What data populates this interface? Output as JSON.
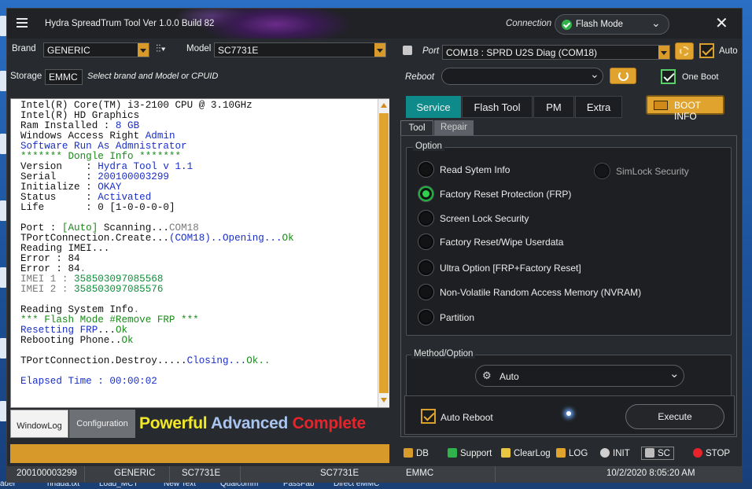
{
  "window": {
    "title": "Hydra SpreadTrum Tool  Ver 1.0.0 Build 82",
    "connection_label": "Connection",
    "connection_mode": "Flash Mode",
    "close_glyph": "✕"
  },
  "device": {
    "brand_label": "Brand",
    "brand_value": "GENERIC",
    "model_label": "Model",
    "model_value": "SC7731E",
    "storage_label": "Storage",
    "storage_value": "EMMC",
    "hint": "Select brand and Model or CPUID"
  },
  "port": {
    "label": "Port",
    "value": "COM18 : SPRD U2S Diag (COM18)",
    "auto_label": "Auto",
    "auto_checked": true,
    "reboot_label": "Reboot",
    "reboot_value": "",
    "one_boot_label": "One Boot",
    "one_boot_checked": true
  },
  "log": {
    "lines": [
      [
        {
          "t": "Intel(R) Core(TM) i3-2100 CPU @ 3.10GHz",
          "c": ""
        }
      ],
      [
        {
          "t": "Intel(R) HD Graphics",
          "c": ""
        }
      ],
      [
        {
          "t": "Ram Installed : ",
          "c": ""
        },
        {
          "t": "8 GB",
          "c": "c-blue"
        }
      ],
      [
        {
          "t": "Windows Access Right ",
          "c": ""
        },
        {
          "t": "Admin",
          "c": "c-blue"
        }
      ],
      [
        {
          "t": "Software Run As Admnistrator",
          "c": "c-blue"
        }
      ],
      [
        {
          "t": "******* Dongle Info *******",
          "c": "c-green"
        }
      ],
      [
        {
          "t": "Version    : ",
          "c": ""
        },
        {
          "t": "Hydra Tool v 1.1",
          "c": "c-blue"
        }
      ],
      [
        {
          "t": "Serial     : ",
          "c": ""
        },
        {
          "t": "200100003299",
          "c": "c-blue"
        }
      ],
      [
        {
          "t": "Initialize : ",
          "c": ""
        },
        {
          "t": "OKAY",
          "c": "c-blue"
        }
      ],
      [
        {
          "t": "Status     : ",
          "c": ""
        },
        {
          "t": "Activated",
          "c": "c-blue"
        }
      ],
      [
        {
          "t": "Life       : ",
          "c": ""
        },
        {
          "t": "0 [1-0-0-0-0]",
          "c": ""
        }
      ],
      [
        {
          "t": "",
          "c": ""
        }
      ],
      [
        {
          "t": "Port : ",
          "c": ""
        },
        {
          "t": "[Auto]",
          "c": "c-green"
        },
        {
          "t": " Scanning...",
          "c": ""
        },
        {
          "t": "COM18",
          "c": "c-gray"
        }
      ],
      [
        {
          "t": "TPortConnection.Create...",
          "c": ""
        },
        {
          "t": "(COM18)..Opening...",
          "c": "c-blue"
        },
        {
          "t": "Ok",
          "c": "c-green"
        }
      ],
      [
        {
          "t": "Reading IMEI...",
          "c": ""
        }
      ],
      [
        {
          "t": "Error : 84",
          "c": ""
        }
      ],
      [
        {
          "t": "Error : 84",
          "c": ""
        },
        {
          "t": ".",
          "c": "c-gray"
        }
      ],
      [
        {
          "t": "IMEI 1 : ",
          "c": "c-gray"
        },
        {
          "t": "358503097085568",
          "c": "c-dgreen"
        }
      ],
      [
        {
          "t": "IMEI 2 : ",
          "c": "c-gray"
        },
        {
          "t": "358503097085576",
          "c": "c-dgreen"
        }
      ],
      [
        {
          "t": "",
          "c": ""
        }
      ],
      [
        {
          "t": "Reading System Info",
          "c": ""
        },
        {
          "t": ".",
          "c": "c-gray"
        }
      ],
      [
        {
          "t": "*** Flash Mode #Remove FRP ***",
          "c": "c-green"
        }
      ],
      [
        {
          "t": "Resetting FRP",
          "c": "c-blue"
        },
        {
          "t": "...",
          "c": ""
        },
        {
          "t": "Ok",
          "c": "c-green"
        }
      ],
      [
        {
          "t": "Rebooting Phone..",
          "c": ""
        },
        {
          "t": "Ok",
          "c": "c-green"
        }
      ],
      [
        {
          "t": "",
          "c": ""
        }
      ],
      [
        {
          "t": "TPortConnection.Destroy.....",
          "c": ""
        },
        {
          "t": "Closing...",
          "c": "c-blue"
        },
        {
          "t": "Ok..",
          "c": "c-green"
        }
      ],
      [
        {
          "t": "",
          "c": ""
        }
      ],
      [
        {
          "t": "Elapsed Time : 00:00:02",
          "c": "c-blue"
        }
      ]
    ]
  },
  "left_tabs": {
    "windowlog": "WindowLog",
    "configuration": "Configuration"
  },
  "slogan": {
    "w1": "Powerful",
    "w2": "Advanced",
    "w3": "Complete",
    "c1": "#f2e82a",
    "c2": "#a9c4ee",
    "c3": "#e8242a"
  },
  "main_tabs": [
    "Service",
    "Flash Tool",
    "PM",
    "Extra"
  ],
  "boot_info_label": "BOOT INFO",
  "sub_tabs": [
    "Tool",
    "Repair"
  ],
  "option_group": {
    "title": "Option",
    "left": [
      {
        "label": "Read Sytem Info",
        "selected": false
      },
      {
        "label": "Factory Reset Protection (FRP)",
        "selected": true
      },
      {
        "label": "Screen Lock Security",
        "selected": false
      },
      {
        "label": "Factory Reset/Wipe Userdata",
        "selected": false
      },
      {
        "label": "Ultra Option [FRP+Factory Reset]",
        "selected": false
      },
      {
        "label": "Non-Volatile Random Access Memory (NVRAM)",
        "selected": false
      },
      {
        "label": "Partition",
        "selected": false
      }
    ],
    "right": {
      "label": "SimLock Security",
      "selected": false
    }
  },
  "method_group": {
    "title": "Method/Option",
    "value": "Auto"
  },
  "auto_reboot": {
    "label": "Auto Reboot",
    "checked": true
  },
  "execute_label": "Execute",
  "toolbar": {
    "db": "DB",
    "support": "Support",
    "clearlog": "ClearLog",
    "log": "LOG",
    "init": "INIT",
    "sc": "SC",
    "stop": "STOP"
  },
  "status": {
    "serial": "200100003299",
    "brand": "GENERIC",
    "model1": "SC7731E",
    "model2": "SC7731E",
    "storage": "EMMC",
    "datetime": "10/2/2020 8:05:20 AM"
  },
  "taskbar": {
    "items": [
      "ader",
      "hhada.txt",
      "Load_MCT",
      "New Text",
      "Qualcomm",
      "PassFab",
      "Direct eMMC"
    ]
  }
}
